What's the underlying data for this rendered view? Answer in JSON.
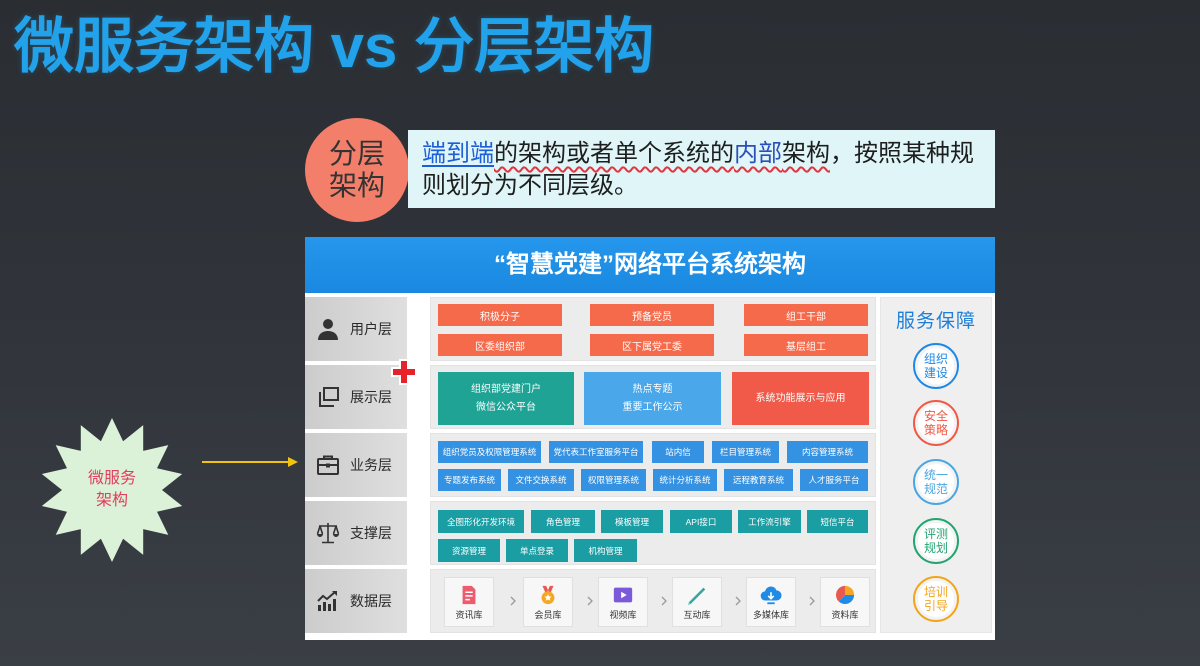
{
  "slide": {
    "title": "微服务架构 vs 分层架构",
    "badge": {
      "line1": "分层",
      "line2": "架构"
    },
    "definition": {
      "seg1": "端到端",
      "seg2": "的架构或者单个系统的",
      "seg3": "内部",
      "seg4": "架构",
      "seg5": "，按照某种规则划分为不同层级。"
    },
    "burst": {
      "line1": "微服务",
      "line2": "架构"
    },
    "colors": {
      "title": "#22a2ea",
      "badge": "#f37f6a",
      "definition_bg": "#dff5f8",
      "starburst": "#dcf2d8",
      "burst_text": "#e23e5e",
      "arrow": "#f2c40f"
    }
  },
  "diagram": {
    "title": "“智慧党建”网络平台系统架构",
    "colors": {
      "header": "#1e8fe6",
      "user_layer": "#f46a4b",
      "business_layer": "#3592e2",
      "support_layer": "#1a9da3",
      "marker": "#e6232a"
    },
    "layers": [
      {
        "name": "用户层",
        "icon": "user-icon"
      },
      {
        "name": "展示层",
        "icon": "windows-icon"
      },
      {
        "name": "业务层",
        "icon": "briefcase-icon"
      },
      {
        "name": "支撑层",
        "icon": "scale-icon"
      },
      {
        "name": "数据层",
        "icon": "chart-icon"
      }
    ],
    "user_layer": [
      "积极分子",
      "预备党员",
      "组工干部",
      "区委组织部",
      "区下属党工委",
      "基层组工"
    ],
    "presentation_layer": [
      {
        "line1": "组织部党建门户",
        "line2": "微信公众平台",
        "color": "#1ea395"
      },
      {
        "line1": "热点专题",
        "line2": "重要工作公示",
        "color": "#4aa7e9"
      },
      {
        "line1": "系统功能展示与应用",
        "color": "#f15a49"
      }
    ],
    "business_layer": [
      "组织党员及权限管理系统",
      "党代表工作室服务平台",
      "站内信",
      "栏目管理系统",
      "内容管理系统",
      "专题发布系统",
      "文件交换系统",
      "权限管理系统",
      "统计分析系统",
      "远程教育系统",
      "人才服务平台"
    ],
    "support_layer": [
      "全图形化开发环境",
      "角色管理",
      "模板管理",
      "API接口",
      "工作流引擎",
      "短信平台",
      "资源管理",
      "单点登录",
      "机构管理"
    ],
    "data_layer": [
      {
        "label": "资讯库",
        "icon": "document-icon"
      },
      {
        "label": "会员库",
        "icon": "medal-icon"
      },
      {
        "label": "视频库",
        "icon": "video-icon"
      },
      {
        "label": "互动库",
        "icon": "interaction-icon"
      },
      {
        "label": "多媒体库",
        "icon": "cloud-download-icon"
      },
      {
        "label": "资料库",
        "icon": "pie-chart-icon"
      }
    ],
    "service": {
      "title": "服务保障",
      "items": [
        {
          "line1": "组织",
          "line2": "建设",
          "color": "#1e88e5"
        },
        {
          "line1": "安全",
          "line2": "策略",
          "color": "#ef5a45"
        },
        {
          "line1": "统一",
          "line2": "规范",
          "color": "#4ba6e0"
        },
        {
          "line1": "评测",
          "line2": "规划",
          "color": "#23a572"
        },
        {
          "line1": "培训",
          "line2": "引导",
          "color": "#f2a51c"
        }
      ]
    }
  }
}
